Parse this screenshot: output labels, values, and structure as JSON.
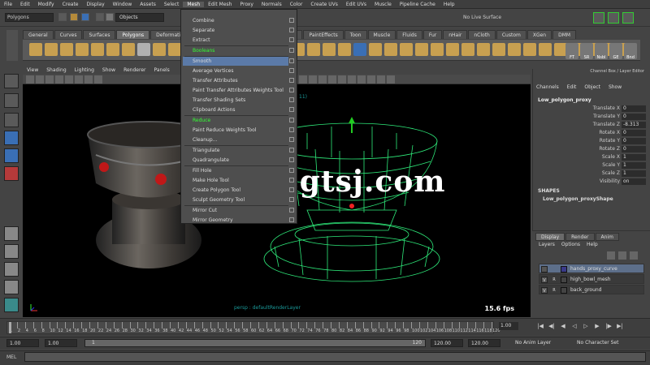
{
  "menubar": {
    "items": [
      "File",
      "Edit",
      "Modify",
      "Create",
      "Display",
      "Window",
      "Assets",
      "Select",
      "Mesh",
      "Edit Mesh",
      "Proxy",
      "Normals",
      "Color",
      "Create UVs",
      "Edit UVs",
      "Muscle",
      "Pipeline Cache",
      "Help"
    ],
    "active": "Mesh"
  },
  "statusline": {
    "mode": "Polygons",
    "objects_label": "Objects",
    "no_live_surface": "No Live Surface"
  },
  "shelf": {
    "tabs": [
      "General",
      "Curves",
      "Surfaces",
      "Polygons",
      "Deformation",
      "Animation",
      "Dynamics",
      "Rendering",
      "PaintEffects",
      "Toon",
      "Muscle",
      "Fluids",
      "Fur",
      "nHair",
      "nCloth",
      "Custom",
      "XGen",
      "DMM"
    ],
    "active_tab": "Polygons",
    "right_icon_labels": [
      "FT",
      "SR",
      "Nsbl",
      "GE",
      "Bnd"
    ]
  },
  "panel": {
    "menus": [
      "View",
      "Shading",
      "Lighting",
      "Show",
      "Renderer",
      "Panels"
    ]
  },
  "viewport": {
    "camera_label": "persp : defaultRenderLayer",
    "fps": "15.6 fps",
    "watermark": "www.cgtsj.com",
    "hud_number": "11)"
  },
  "mesh_menu": {
    "items": [
      {
        "label": "Combine",
        "highlighted": false
      },
      {
        "label": "Separate",
        "highlighted": false
      },
      {
        "label": "Extract",
        "highlighted": false
      },
      {
        "label": "Booleans",
        "highlighted": false,
        "green": true
      },
      {
        "label": "Smooth",
        "highlighted": true
      },
      {
        "label": "Average Vertices",
        "highlighted": false
      },
      {
        "label": "Transfer Attributes",
        "highlighted": false
      },
      {
        "label": "Paint Transfer Attributes Weights Tool",
        "highlighted": false
      },
      {
        "label": "Transfer Shading Sets",
        "highlighted": false
      },
      {
        "label": "Clipboard Actions",
        "highlighted": false
      },
      {
        "label": "Reduce",
        "highlighted": false,
        "green": true
      },
      {
        "label": "Paint Reduce Weights Tool",
        "highlighted": false
      },
      {
        "label": "Cleanup...",
        "highlighted": false
      },
      {
        "label": "Triangulate",
        "highlighted": false
      },
      {
        "label": "Quadrangulate",
        "highlighted": false
      },
      {
        "label": "Fill Hole",
        "highlighted": false
      },
      {
        "label": "Make Hole Tool",
        "highlighted": false
      },
      {
        "label": "Create Polygon Tool",
        "highlighted": false
      },
      {
        "label": "Sculpt Geometry Tool",
        "highlighted": false
      },
      {
        "label": "Mirror Cut",
        "highlighted": false
      },
      {
        "label": "Mirror Geometry",
        "highlighted": false
      }
    ]
  },
  "channel_box": {
    "header": "Channel Box / Layer Editor",
    "tabs": [
      "Channels",
      "Edit",
      "Object",
      "Show"
    ],
    "object_name": "Low_polygon_proxy",
    "attributes": [
      {
        "label": "Translate X",
        "value": "0"
      },
      {
        "label": "Translate Y",
        "value": "0"
      },
      {
        "label": "Translate Z",
        "value": "-8.313"
      },
      {
        "label": "Rotate X",
        "value": "0"
      },
      {
        "label": "Rotate Y",
        "value": "0"
      },
      {
        "label": "Rotate Z",
        "value": "0"
      },
      {
        "label": "Scale X",
        "value": "1"
      },
      {
        "label": "Scale Y",
        "value": "1"
      },
      {
        "label": "Scale Z",
        "value": "1"
      },
      {
        "label": "Visibility",
        "value": "on"
      }
    ],
    "shapes_label": "SHAPES",
    "shape_name": "Low_polygon_proxyShape"
  },
  "layer_editor": {
    "tabs": [
      "Display",
      "Render",
      "Anim"
    ],
    "active_tab": "Display",
    "menus": [
      "Layers",
      "Options",
      "Help"
    ],
    "layers": [
      {
        "v": "",
        "p": "",
        "color": "#3a3a8a",
        "name": "hands_proxy_curve",
        "selected": true
      },
      {
        "v": "V",
        "p": "R",
        "color": "#444",
        "name": "high_bowl_mesh",
        "selected": false
      },
      {
        "v": "V",
        "p": "R",
        "color": "#444",
        "name": "back_ground",
        "selected": false
      }
    ]
  },
  "timeslider": {
    "ticks": [
      "1",
      "2",
      "4",
      "6",
      "8",
      "10",
      "12",
      "14",
      "16",
      "18",
      "20",
      "22",
      "24",
      "26",
      "28",
      "30",
      "32",
      "34",
      "36",
      "38",
      "40",
      "42",
      "44",
      "46",
      "48",
      "50",
      "52",
      "54",
      "56",
      "58",
      "60",
      "62",
      "64",
      "66",
      "68",
      "70",
      "72",
      "74",
      "76",
      "78",
      "80",
      "82",
      "84",
      "86",
      "88",
      "90",
      "92",
      "94",
      "96",
      "98",
      "100",
      "102",
      "104",
      "106",
      "108",
      "110",
      "112",
      "114",
      "116",
      "118",
      "120"
    ],
    "current_frame": "1.00"
  },
  "range": {
    "start": "1.00",
    "inner_start": "1.00",
    "bar_label": "1",
    "bar_end": "120",
    "inner_end": "120.00",
    "end": "120.00",
    "anim_layer": "No Anim Layer",
    "character_set": "No Character Set"
  },
  "cmdline": {
    "label": "MEL"
  }
}
